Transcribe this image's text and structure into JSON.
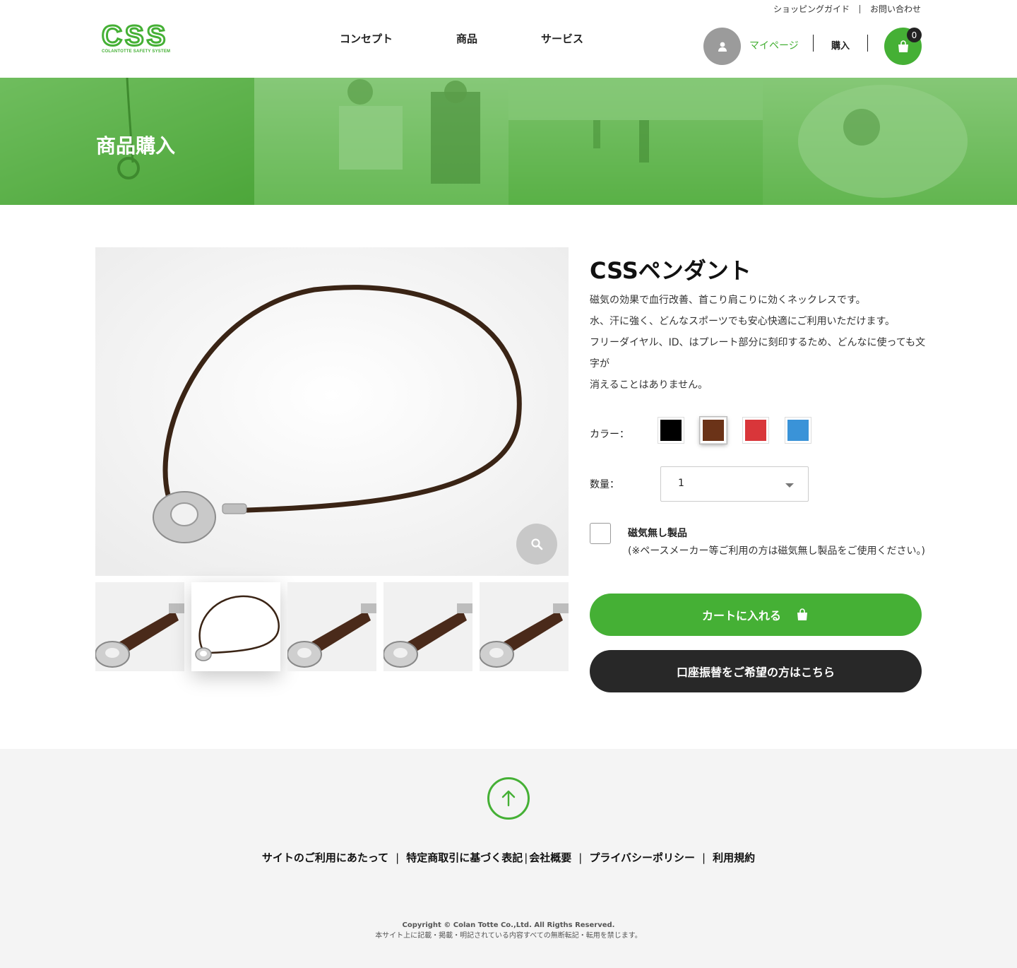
{
  "header": {
    "utility_links": [
      "ショッピングガイド",
      "お問い合わせ"
    ],
    "logo_text": "CSS",
    "logo_sub": "COLANTOTTE SAFETY SYSTEM",
    "nav": [
      "コンセプト",
      "商品",
      "サービス"
    ],
    "mypage": "マイページ",
    "buy": "購入",
    "cart_count": "0"
  },
  "hero": {
    "title": "商品購入"
  },
  "product": {
    "name": "CSSペンダント",
    "description": [
      "磁気の効果で血行改善、首こり肩こりに効くネックレスです。",
      "水、汗に強く、どんなスポーツでも安心快適にご利用いただけます。",
      "フリーダイヤル、ID、はプレート部分に刻印するため、どんなに使っても文字が",
      "消えることはありません。"
    ],
    "color_label": "カラー：",
    "colors": [
      {
        "name": "black",
        "hex": "#000000"
      },
      {
        "name": "brown",
        "hex": "#6b3318"
      },
      {
        "name": "red",
        "hex": "#d9363a"
      },
      {
        "name": "blue",
        "hex": "#3a93d8"
      }
    ],
    "selected_color": "brown",
    "quantity_label": "数量：",
    "quantity_value": "1",
    "nonmagnetic_label": "磁気無し製品",
    "nonmagnetic_note": "(※ペースメーカー等ご利用の方は磁気無し製品をご使用ください。)",
    "add_to_cart": "カートに入れる",
    "bank_transfer": "口座振替をご希望の方はこちら",
    "active_thumb_index": 1
  },
  "footer": {
    "links": [
      "サイトのご利用にあたって",
      "特定商取引に基づく表記",
      "会社概要",
      "プライバシーポリシー",
      "利用規約"
    ],
    "copyright": "Copyright © Colan Totte Co.,Ltd. All Rigths Reserved.",
    "notice": "本サイト上に記載・掲載・明記されている内容すべての無断転記・転用を禁じます。"
  },
  "colors": {
    "brand_green": "#45b035",
    "dark": "#282828"
  }
}
